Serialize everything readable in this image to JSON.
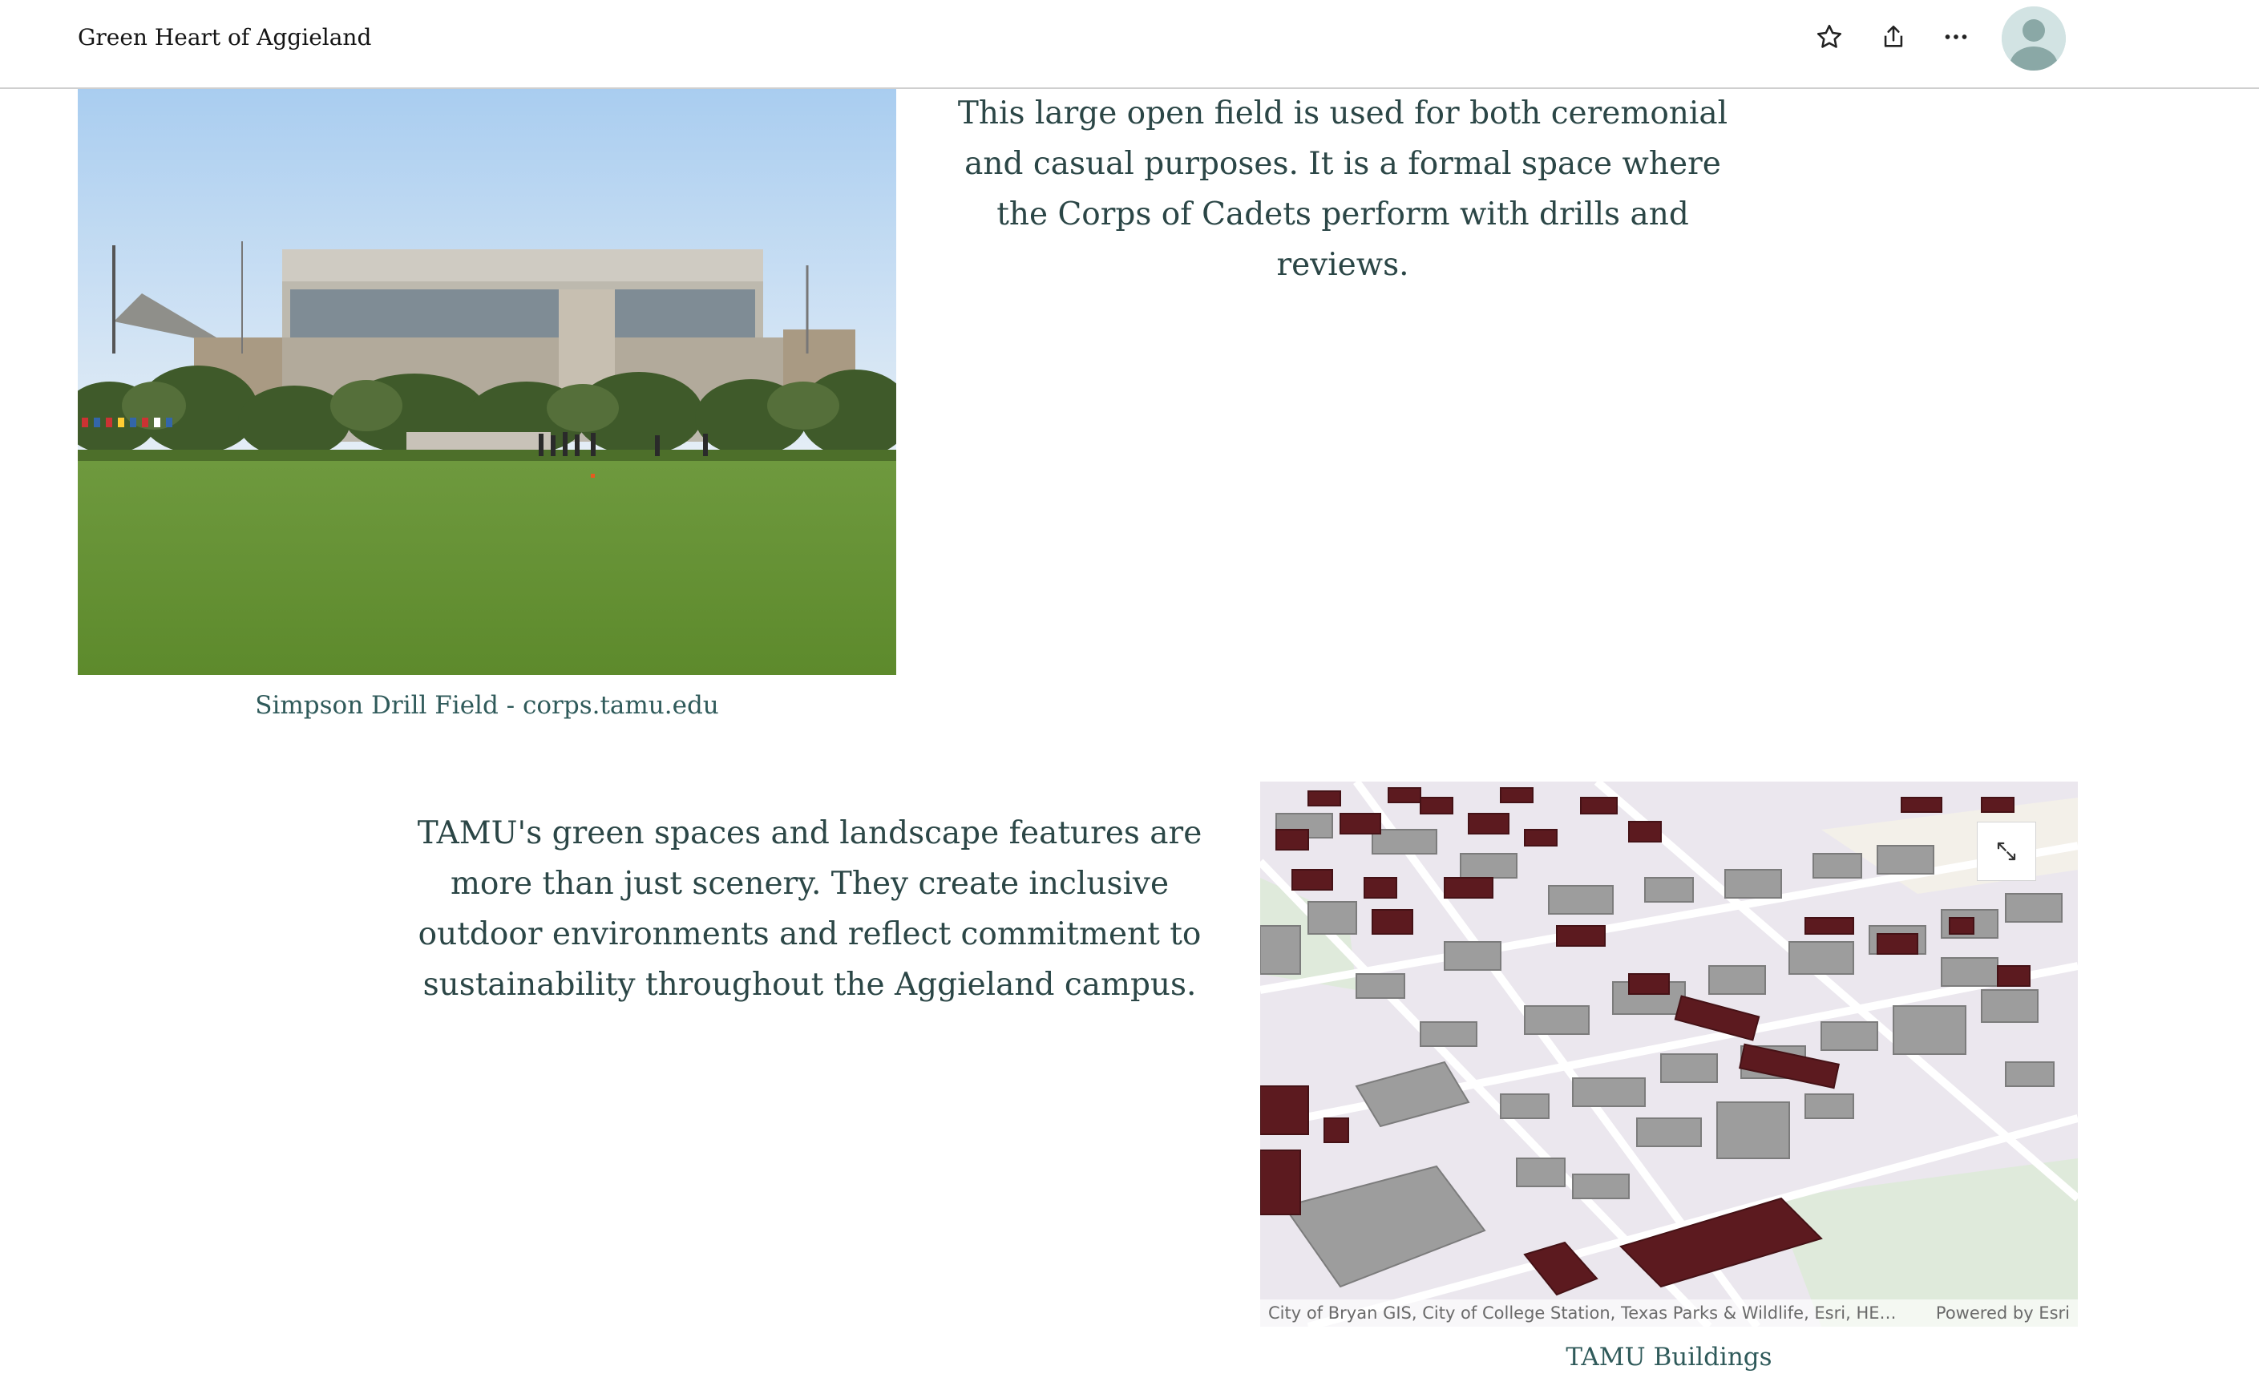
{
  "header": {
    "story_title": "Green Heart of Aggieland",
    "icons": [
      "star-icon",
      "share-icon",
      "more-icon",
      "user-avatar-icon"
    ]
  },
  "section1": {
    "image_caption": "Simpson Drill Field - corps.tamu.edu",
    "paragraph": "This large open field is used for both ceremonial and casual purposes. It is a formal space where the Corps of Cadets perform with drills and reviews."
  },
  "section2": {
    "paragraph": "TAMU's green spaces and landscape features are more than just scenery. They create inclusive outdoor environments and reflect commitment to sustainability throughout the Aggieland campus.",
    "map_caption": "TAMU Buildings",
    "map": {
      "attribution": "City of Bryan GIS, City of College Station, Texas Parks & Wildlife, Esri, HE…",
      "powered_by": "Powered by Esri",
      "expand_icon": "expand-icon"
    }
  },
  "colors": {
    "maroon": "#5c1a1f",
    "building_gray": "#9a9a9a",
    "text_teal": "#2b4646",
    "caption_teal": "#2f5a5a"
  }
}
